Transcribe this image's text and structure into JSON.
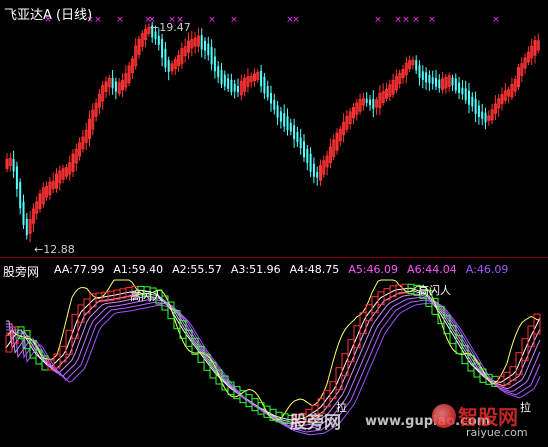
{
  "top_panel": {
    "title": "飞亚达A (日线)",
    "peak_label": "19.47",
    "low_label": "12.88"
  },
  "bottom_panel": {
    "indicator_name": "股旁网",
    "values": [
      {
        "label": "AA:",
        "value": "77.99",
        "color": "#ffffff"
      },
      {
        "label": "A1:",
        "value": "59.40",
        "color": "#ffffff"
      },
      {
        "label": "A2:",
        "value": "55.57",
        "color": "#ffffff"
      },
      {
        "label": "A3:",
        "value": "51.96",
        "color": "#ffffff"
      },
      {
        "label": "A4:",
        "value": "48.75",
        "color": "#ffffff"
      },
      {
        "label": "A5:",
        "value": "46.09",
        "color": "#ff55ff"
      },
      {
        "label": "A6:",
        "value": "44.04",
        "color": "#ff55ff"
      },
      {
        "label": "A:",
        "value": "46.09",
        "color": "#aa55ff"
      }
    ],
    "flash_label_1": "高闪人",
    "flash_label_2": "高闪人",
    "marker_1": "拉",
    "marker_2": "拉"
  },
  "watermarks": {
    "left": "股旁网",
    "url": "www.gupiao.com",
    "brand": "智股网",
    "domain": "raiyue.com"
  },
  "colors": {
    "up": "#ff3333",
    "down": "#54ffff",
    "background": "#000000",
    "separator": "#8a0000",
    "line_aa": "#ffff66",
    "line_a1": "#ffffff",
    "fan": "#cc66ff"
  }
}
